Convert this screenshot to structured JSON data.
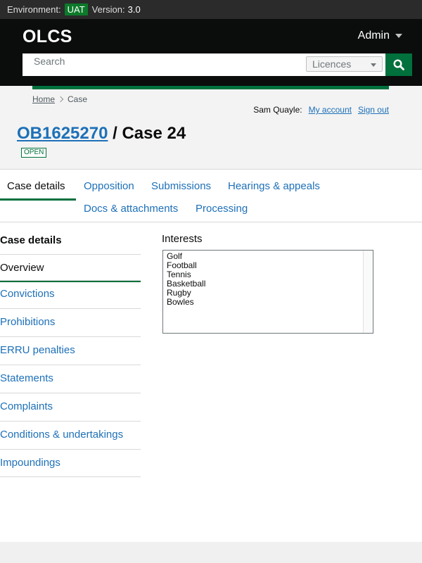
{
  "envbar": {
    "env_label": "Environment:",
    "env_value": "UAT",
    "version_label": "Version:",
    "version_value": "3.0"
  },
  "header": {
    "logo": "OLCS",
    "admin_label": "Admin"
  },
  "search": {
    "placeholder": "Search",
    "scope_selected": "Licences"
  },
  "breadcrumb": {
    "home": "Home",
    "current": "Case"
  },
  "user": {
    "name": "Sam Quayle:",
    "account_link": "My account",
    "signout_link": "Sign out"
  },
  "case": {
    "licence_link": "OB1625270",
    "title_suffix": " / Case 24",
    "status": "OPEN"
  },
  "tabs": [
    {
      "label": "Case details",
      "active": true
    },
    {
      "label": "Opposition"
    },
    {
      "label": "Submissions"
    },
    {
      "label": "Hearings & appeals"
    },
    {
      "label": "Docs & attachments"
    },
    {
      "label": "Processing"
    }
  ],
  "sidenav": {
    "heading": "Case details",
    "items": [
      {
        "label": "Overview",
        "active": true
      },
      {
        "label": "Convictions"
      },
      {
        "label": "Prohibitions"
      },
      {
        "label": "ERRU penalties"
      },
      {
        "label": "Statements"
      },
      {
        "label": "Complaints"
      },
      {
        "label": "Conditions & undertakings"
      },
      {
        "label": "Impoundings"
      }
    ]
  },
  "interests": {
    "label": "Interests",
    "options": [
      "Golf",
      "Football",
      "Tennis",
      "Basketball",
      "Rugby",
      "Bowles"
    ]
  },
  "colors": {
    "brand_green": "#00703c",
    "link_blue": "#1d70b8",
    "header_black": "#0b0c0c"
  }
}
